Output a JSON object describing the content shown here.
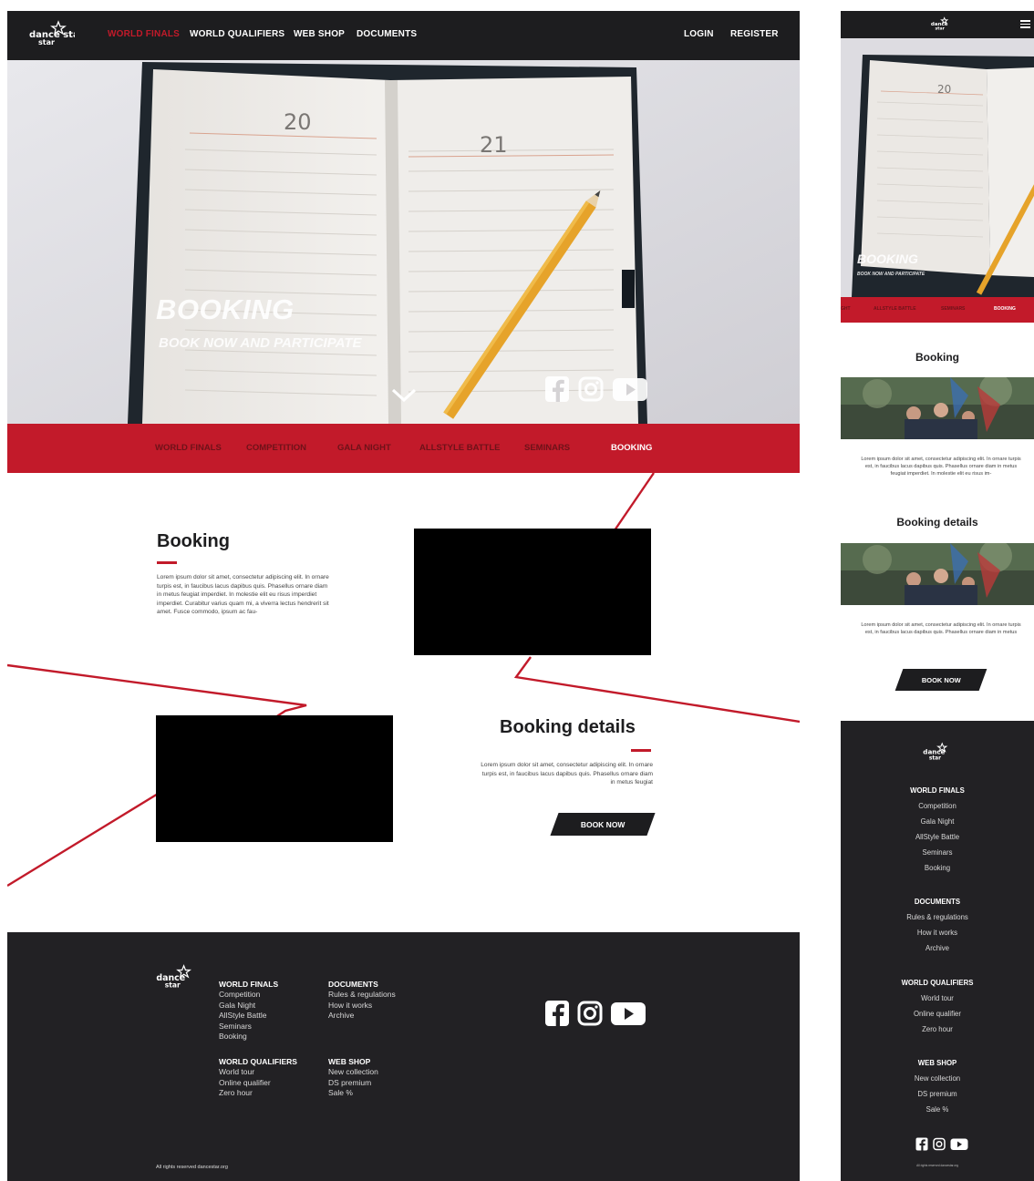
{
  "brand": {
    "logo_text": "dance star",
    "accent": "#c21a2a",
    "dark": "#1d1d1f",
    "footer_bg": "#222124"
  },
  "nav": {
    "items": [
      {
        "label": "WORLD FINALS",
        "active": true
      },
      {
        "label": "WORLD QUALIFIERS"
      },
      {
        "label": "WEB SHOP"
      },
      {
        "label": "DOCUMENTS"
      }
    ],
    "login": "LOGIN",
    "register": "REGISTER"
  },
  "hero": {
    "title": "BOOKING",
    "subtitle": "BOOK NOW AND PARTICIPATE",
    "notebook_left_date": "20",
    "notebook_right_date": "21",
    "social_icons": [
      "facebook-icon",
      "instagram-icon",
      "youtube-icon"
    ]
  },
  "subnav": {
    "items": [
      {
        "label": "WORLD FINALS"
      },
      {
        "label": "COMPETITION"
      },
      {
        "label": "GALA NIGHT"
      },
      {
        "label": "ALLSTYLE BATTLE"
      },
      {
        "label": "SEMINARS"
      },
      {
        "label": "BOOKING",
        "active": true
      }
    ]
  },
  "sections": {
    "booking": {
      "title": "Booking",
      "text": "Lorem ipsum dolor sit amet, consectetur adipiscing elit. In ornare turpis est, in faucibus lacus dapibus quis. Phasellus ornare diam in metus feugiat imperdiet. In molestie elit eu risus imperdiet imperdiet. Curabitur varius quam mi, a viverra lectus hendrerit sit amet. Fusce commodo, ipsum ac fau-"
    },
    "details": {
      "title": "Booking details",
      "text": "Lorem ipsum dolor sit amet, consectetur adipiscing elit. In ornare turpis est, in faucibus lacus dapibus quis. Phasellus ornare diam in metus feugiat",
      "button": "BOOK NOW"
    }
  },
  "footer": {
    "cols": [
      {
        "head": "WORLD FINALS",
        "items": [
          "Competition",
          "Gala Night",
          "AllStyle Battle",
          "Seminars",
          "Booking"
        ]
      },
      {
        "head": "DOCUMENTS",
        "items": [
          "Rules & regulations",
          "How it works",
          "Archive"
        ]
      },
      {
        "head": "WORLD QUALIFIERS",
        "items": [
          "World tour",
          "Online qualifier",
          "Zero hour"
        ]
      },
      {
        "head": "WEB SHOP",
        "items": [
          "New collection",
          "DS premium",
          "Sale %"
        ]
      }
    ],
    "copyright": "All rights reserved dancestar.org"
  },
  "mobile": {
    "hero_title": "BOOKING",
    "hero_subtitle": "BOOK NOW AND PARTICIPATE",
    "subnav": [
      "GHT",
      "ALLSTYLE BATTLE",
      "SEMINARS",
      "BOOKING"
    ],
    "booking_title": "Booking",
    "booking_text": "Lorem ipsum dolor sit amet, consectetur adipiscing elit. In ornare turpis est, in faucibus lacus dapibus quis. Phasellus ornare diam in metus feugiat imperdiet. In molestie elit eu risus im-",
    "details_title": "Booking details",
    "details_text": "Lorem ipsum dolor sit amet, consectetur adipiscing elit. In ornare turpis est, in faucibus lacus dapibus quis. Phasellus ornare diam in metus",
    "button": "BOOK NOW",
    "footer_cols": [
      {
        "head": "WORLD FINALS",
        "items": [
          "Competition",
          "Gala Night",
          "AllStyle Battle",
          "Seminars",
          "Booking"
        ]
      },
      {
        "head": "DOCUMENTS",
        "items": [
          "Rules & regulations",
          "How it works",
          "Archive"
        ]
      },
      {
        "head": "WORLD QUALIFIERS",
        "items": [
          "World tour",
          "Online qualifier",
          "Zero hour"
        ]
      },
      {
        "head": "WEB SHOP",
        "items": [
          "New collection",
          "DS premium",
          "Sale %"
        ]
      }
    ],
    "copyright": "All rights reserved dancestar.org"
  }
}
